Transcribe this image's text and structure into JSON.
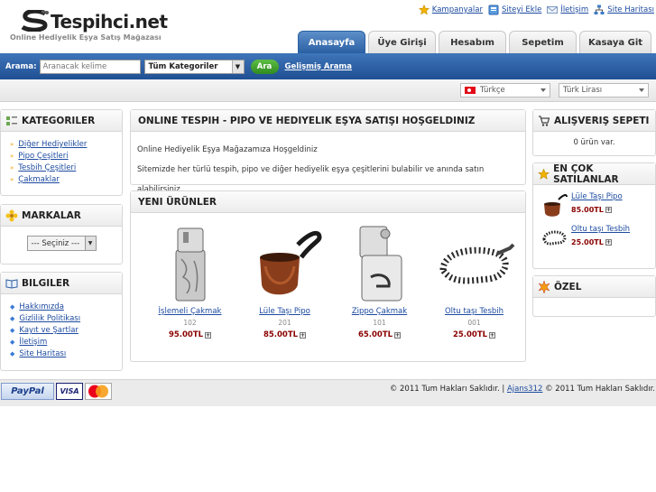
{
  "logo": {
    "title": "Tespihci.net",
    "tagline": "Online Hediyelik Eşya Satış Mağazası"
  },
  "top_links": [
    {
      "label": "Kampanyalar",
      "icon": "star-icon"
    },
    {
      "label": "Siteyi Ekle",
      "icon": "bookmark-icon"
    },
    {
      "label": "İletişim",
      "icon": "mail-icon"
    },
    {
      "label": "Site Haritası",
      "icon": "sitemap-icon"
    }
  ],
  "tabs": [
    "Anasayfa",
    "Üye Girişi",
    "Hesabım",
    "Sepetim",
    "Kasaya Git"
  ],
  "search": {
    "label": "Arama:",
    "placeholder": "Aranacak kelime",
    "category": "Tüm Kategoriler",
    "button": "Ara",
    "advanced": "Gelişmiş Arama"
  },
  "locale": {
    "language": "Türkçe",
    "currency": "Türk Lirası"
  },
  "categories": {
    "title": "KATEGORILER",
    "items": [
      "Diğer Hediyelikler",
      "Pipo Çeşitleri",
      "Tesbih Çeşitleri",
      "Çakmaklar"
    ]
  },
  "brands": {
    "title": "MARKALAR",
    "select": "--- Seçiniz ---"
  },
  "info": {
    "title": "BILGILER",
    "items": [
      "Hakkımızda",
      "Gizlilik Politikası",
      "Kayıt ve Şartlar",
      "İletişim",
      "Site Haritası"
    ]
  },
  "welcome": {
    "title": "ONLINE TESPIH - PIPO VE HEDIYELIK EŞYA SATIŞI HOŞGELDINIZ",
    "line1": "Online Hediyelik Eşya Mağazamıza Hoşgeldiniz",
    "line2": "Sitemizde her türlü tespih, pipo ve diğer hediyelik eşya çeşitlerini bulabilir ve anında satın alabilirsiniz."
  },
  "new_products": {
    "title": "YENI ÜRÜNLER",
    "items": [
      {
        "name": "İşlemeli Çakmak",
        "code": "102",
        "price": "95.00TL"
      },
      {
        "name": "Lüle Taşı Pipo",
        "code": "201",
        "price": "85.00TL"
      },
      {
        "name": "Zippo Çakmak",
        "code": "101",
        "price": "65.00TL"
      },
      {
        "name": "Oltu taşı Tesbih",
        "code": "001",
        "price": "25.00TL"
      }
    ]
  },
  "cart": {
    "title": "ALIŞVERIŞ SEPETI",
    "text": "0 ürün var."
  },
  "bestsellers": {
    "title": "EN ÇOK SATILANLAR",
    "items": [
      {
        "name": "Lüle Taşı Pipo",
        "price": "85.00TL"
      },
      {
        "name": "Oltu taşı Tesbih",
        "price": "25.00TL"
      }
    ]
  },
  "special": {
    "title": "ÖZEL"
  },
  "footer": {
    "copyright1": "© 2011 Tum Hakları Saklıdır. |",
    "link": "Ajans312",
    "copyright2": "© 2011 Tum Hakları Saklıdır.",
    "paypal": "PayPal",
    "visa": "VISA",
    "mastercard": "MasterCard"
  },
  "colors": {
    "accent": "#2a60a4",
    "search_bar": "#1f4f93",
    "price": "#8b0000",
    "link": "#1d4ba0"
  }
}
